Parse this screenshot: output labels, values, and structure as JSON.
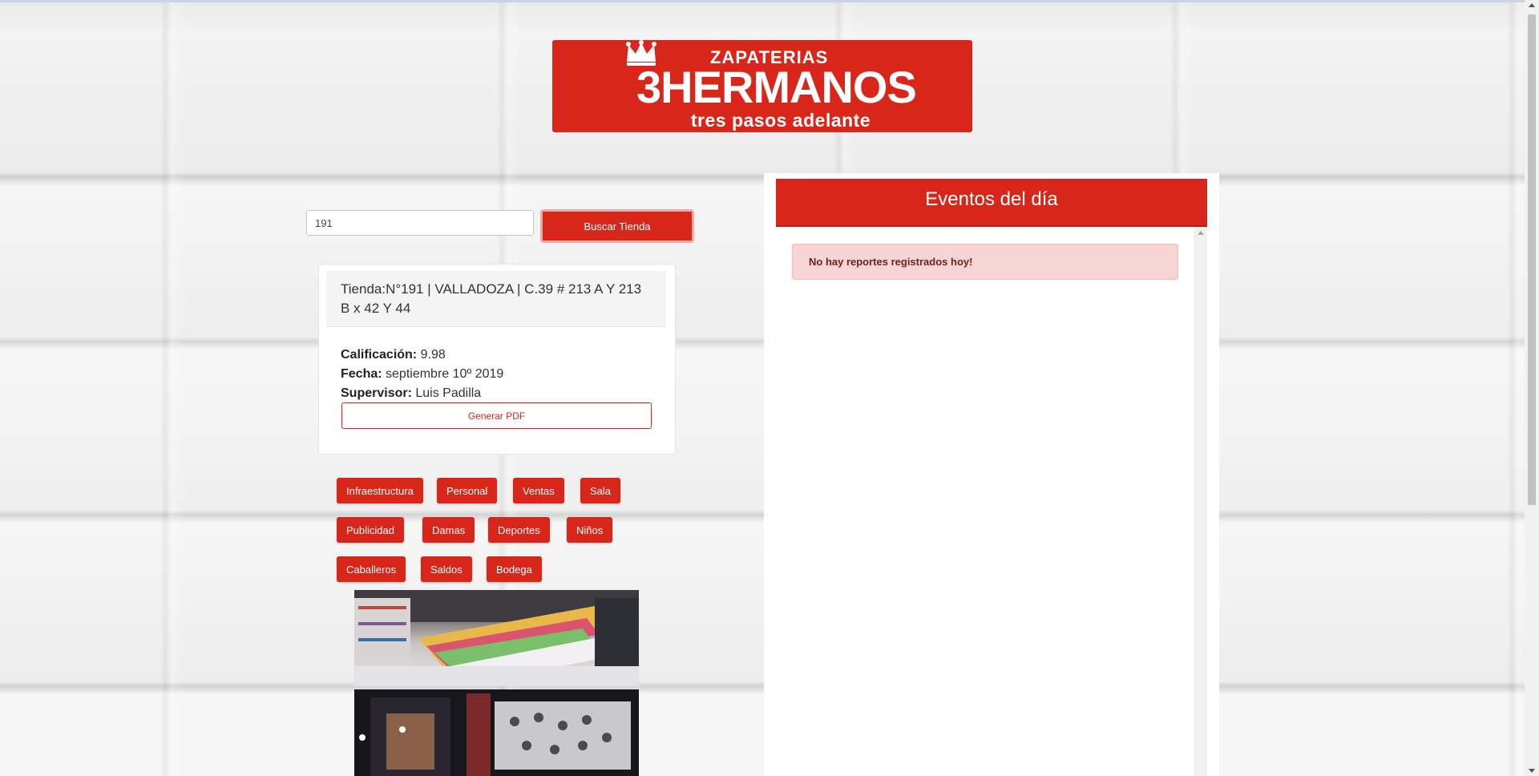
{
  "logo": {
    "top_text": "ZAPATERIAS",
    "main_text": "3HERMANOS",
    "tagline": "tres pasos adelante",
    "brand_color": "#d8261a"
  },
  "search": {
    "value": "191",
    "button_label": "Buscar Tienda"
  },
  "store": {
    "header": "Tienda:N°191 | VALLADOZA | C.39 # 213 A Y 213 B x 42 Y 44",
    "rating_label": "Calificación:",
    "rating_value": "9.98",
    "date_label": "Fecha:",
    "date_value": "septiembre 10º 2019",
    "supervisor_label": "Supervisor:",
    "supervisor_value": "Luis Padilla",
    "pdf_button": "Generar PDF"
  },
  "categories": [
    "Infraestructura",
    "Personal",
    "Ventas",
    "Sala",
    "Publicidad",
    "Damas",
    "Deportes",
    "Niños",
    "Caballeros",
    "Saldos",
    "Bodega"
  ],
  "events": {
    "title": "Eventos del día",
    "empty_message": "No hay reportes registrados hoy!"
  },
  "icons": [
    "crown-icon",
    "scroll-up-arrow-icon",
    "scroll-down-arrow-icon"
  ]
}
